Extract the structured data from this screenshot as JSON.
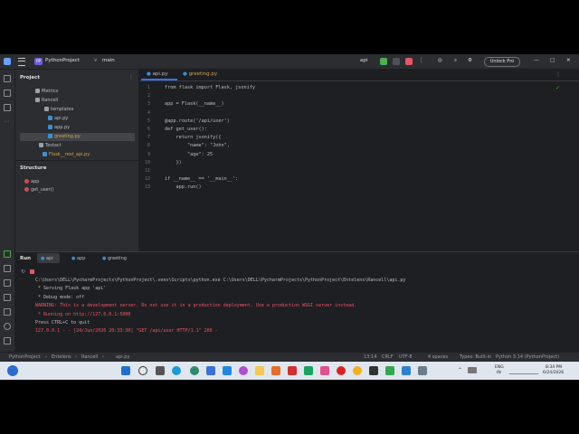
{
  "titlebar": {
    "project": "PythonProject",
    "project_badge": "PP",
    "branch": "main",
    "run_config": "api",
    "unlock": "Unlock Pro"
  },
  "project_panel": {
    "title": "Project",
    "tree": [
      "Metrics",
      "Rancell",
      "templates",
      "api.py",
      "app.py",
      "greeting.py",
      "Testact",
      "Flask__rest_api.py"
    ]
  },
  "structure": {
    "title": "Structure",
    "items": [
      "app",
      "get_user()"
    ]
  },
  "editor": {
    "tabs": [
      "api.py",
      "greeting.py"
    ],
    "lines": [
      {
        "n": "1",
        "t": "from flask import Flask, jsonify"
      },
      {
        "n": "2",
        "t": ""
      },
      {
        "n": "3",
        "t": "app = Flask(__name__)"
      },
      {
        "n": "4",
        "t": ""
      },
      {
        "n": "5",
        "t": "@app.route('/api/user')"
      },
      {
        "n": "6",
        "t": "def get_user():"
      },
      {
        "n": "7",
        "t": "    return jsonify({"
      },
      {
        "n": "8",
        "t": "        \"name\": \"John\","
      },
      {
        "n": "9",
        "t": "        \"age\": 25"
      },
      {
        "n": "10",
        "t": "    })"
      },
      {
        "n": "11",
        "t": ""
      },
      {
        "n": "12",
        "t": "if __name__ == '__main__':"
      },
      {
        "n": "13",
        "t": "    app.run()"
      }
    ]
  },
  "run": {
    "label": "Run",
    "tabs": [
      "api",
      "app",
      "greeting"
    ],
    "output": [
      "C:\\Users\\DELL\\PycharmProjects\\PythonProject\\.venv\\Scripts\\python.exe C:\\Users\\DELL\\PycharmProjects\\PythonProject\\Entelens\\Rancell\\api.py",
      " * Serving Flask app 'api'",
      " * Debug mode: off",
      "WARNING: This is a development server. Do not use it in a production deployment. Use a production WSGI server instead.",
      " * Running on http://127.0.0.1:5000",
      "Press CTRL+C to quit",
      "127.0.0.1 - - [24/Jun/2026 20:33:30] \"GET /api/user HTTP/1.1\" 200 -"
    ]
  },
  "statusbar": {
    "breadcrumb": [
      "PythonProject",
      "Entelens",
      "Rancell",
      "api.py"
    ],
    "position": "13:14",
    "eol": "CRLF",
    "encoding": "UTF-8",
    "indent": "4 spaces",
    "types": "Types: Built-in",
    "interpreter": "Python 3.14 (PythonProject)"
  },
  "taskbar": {
    "lang": "ENG",
    "region": "IN",
    "time": "8:34 PM",
    "date": "6/24/2026"
  },
  "colors": {
    "accent": "#3574f0",
    "run_green": "#4caf50",
    "stop_red": "#e55765"
  }
}
